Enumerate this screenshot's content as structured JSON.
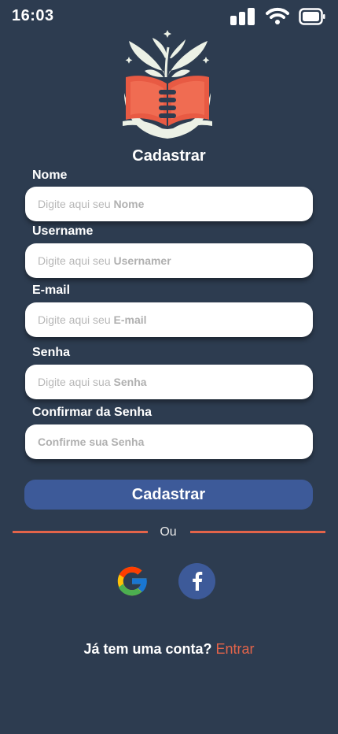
{
  "status": {
    "time": "16:03"
  },
  "title": "Cadastrar",
  "fields": [
    {
      "label": "Nome",
      "placeholder_prefix": "Digite aqui seu ",
      "placeholder_bold": "Nome"
    },
    {
      "label": "Username",
      "placeholder_prefix": "Digite aqui seu ",
      "placeholder_bold": "Usernamer"
    },
    {
      "label": "E-mail",
      "placeholder_prefix": "Digite aqui seu ",
      "placeholder_bold": "E-mail"
    },
    {
      "label": "Senha",
      "placeholder_prefix": "Digite aqui sua ",
      "placeholder_bold": "Senha"
    },
    {
      "label": "Confirmar da Senha",
      "placeholder_prefix": "",
      "placeholder_bold": "Confirme sua Senha"
    }
  ],
  "submit_label": "Cadastrar",
  "divider_text": "Ou",
  "social": {
    "google": "google-icon",
    "facebook": "facebook-icon"
  },
  "footer": {
    "question": "Já tem uma conta?",
    "link": "Entrar"
  },
  "colors": {
    "background": "#2d3c50",
    "primary": "#3d5a99",
    "accent": "#e3644a"
  }
}
